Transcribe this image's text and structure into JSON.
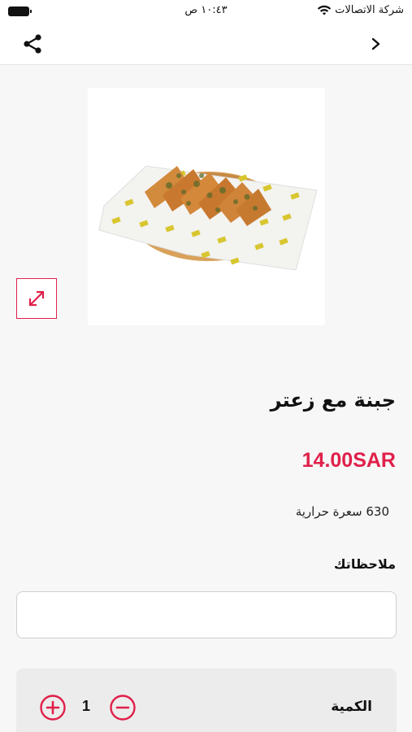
{
  "status_bar": {
    "carrier": "شركة الاتصالات",
    "time": "١٠:٤٣ ص",
    "icons": [
      "wifi-icon",
      "battery-icon"
    ]
  },
  "nav": {
    "icons": [
      "share-icon",
      "chevron-right-icon"
    ]
  },
  "product": {
    "name": "جبنة مع زعتر",
    "price": "14.00SAR",
    "calories": "630 سعرة حرارية",
    "image_icon": "expand-icon"
  },
  "notes": {
    "label": "ملاحظاتك",
    "value": ""
  },
  "quantity": {
    "label": "الكمية",
    "value": "1",
    "icons": [
      "plus-circle-icon",
      "minus-circle-icon"
    ]
  },
  "colors": {
    "accent": "#e0204a",
    "background": "#f7f7f7",
    "panel": "#ececec"
  }
}
